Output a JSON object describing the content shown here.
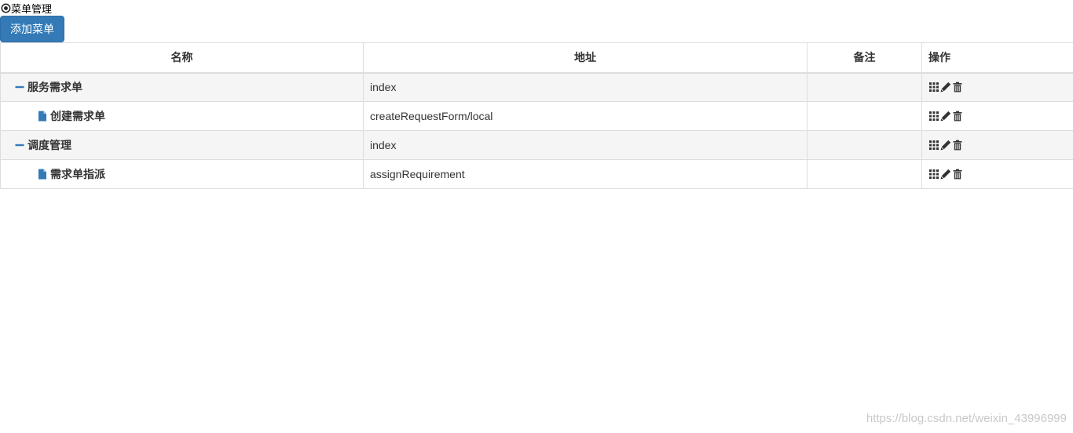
{
  "header": {
    "title": "菜单管理",
    "title_icon": "record-circle-icon"
  },
  "toolbar": {
    "add_label": "添加菜单",
    "button_color": "#337ab7"
  },
  "table": {
    "columns": [
      "名称",
      "地址",
      "备注",
      "操作"
    ],
    "rows": [
      {
        "name": "服务需求单",
        "url": "index",
        "note": "",
        "level": 0,
        "icon": "minus-icon"
      },
      {
        "name": "创建需求单",
        "url": "createRequestForm/local",
        "note": "",
        "level": 1,
        "icon": "file-icon"
      },
      {
        "name": "调度管理",
        "url": "index",
        "note": "",
        "level": 0,
        "icon": "minus-icon"
      },
      {
        "name": "需求单指派",
        "url": "assignRequirement",
        "note": "",
        "level": 1,
        "icon": "file-icon"
      }
    ],
    "actions": [
      "grid-icon",
      "pencil-icon",
      "trash-icon"
    ]
  },
  "watermark": "https://blog.csdn.net/weixin_43996999",
  "colors": {
    "accent": "#337ab7",
    "stripe": "#f5f5f5",
    "border": "#dddddd"
  }
}
